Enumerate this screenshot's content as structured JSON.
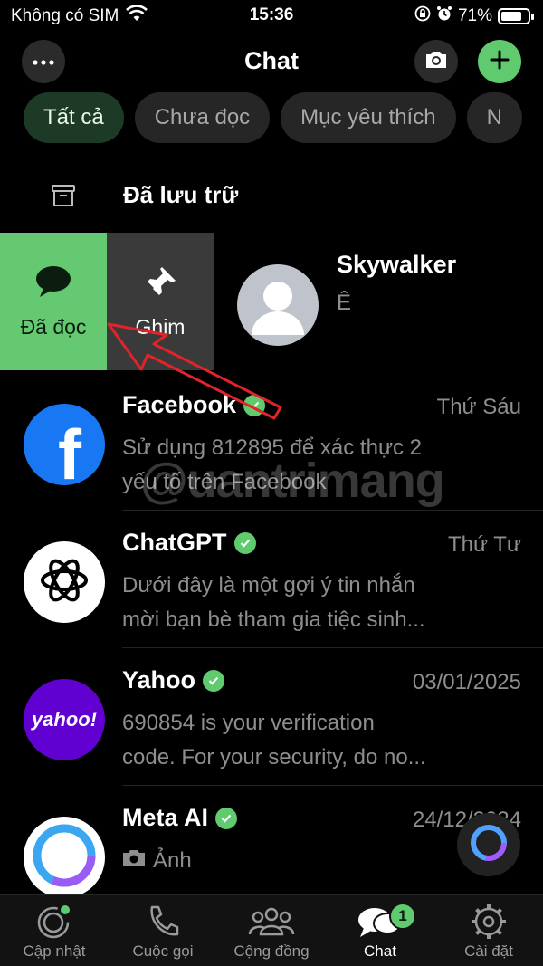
{
  "status_bar": {
    "carrier": "Không có SIM",
    "time": "15:36",
    "battery": "71%"
  },
  "header": {
    "title": "Chat"
  },
  "filters": [
    "Tất cả",
    "Chưa đọc",
    "Mục yêu thích",
    "N"
  ],
  "archived": {
    "label": "Đã lưu trữ"
  },
  "swipe_actions": {
    "read_label": "Đã đọc",
    "pin_label": "Ghim"
  },
  "swiped_chat": {
    "name": "Skywalker",
    "preview": "Ê"
  },
  "chats": [
    {
      "name": "Facebook",
      "date": "Thứ Sáu",
      "preview_line1": "Sử dụng 812895 để xác thực 2",
      "preview_line2": "yếu tố trên Facebook"
    },
    {
      "name": "ChatGPT",
      "date": "Thứ Tư",
      "preview_line1": "Dưới đây là một gợi ý tin nhắn",
      "preview_line2": "mời bạn bè tham gia tiệc sinh..."
    },
    {
      "name": "Yahoo",
      "date": "03/01/2025",
      "preview_line1": "690854 is your verification",
      "preview_line2": "code. For your security, do no..."
    },
    {
      "name": "Meta AI",
      "date": "24/12/2024",
      "preview_line1": "Ảnh",
      "preview_line2": ""
    }
  ],
  "avatar_text": {
    "facebook": "f",
    "yahoo": "yahoo!"
  },
  "tabs": [
    {
      "label": "Cập nhật"
    },
    {
      "label": "Cuộc gọi"
    },
    {
      "label": "Cộng đồng"
    },
    {
      "label": "Chat",
      "badge": "1"
    },
    {
      "label": "Cài đặt"
    }
  ],
  "watermark": "@uantrimang",
  "colors": {
    "accent": "#5fcb6e",
    "read_action": "#64c970",
    "pin_action": "#3a3a3a",
    "facebook": "#1877f2",
    "yahoo": "#6001d2"
  },
  "icons": [
    "wifi-icon",
    "lock-rotation-icon",
    "alarm-icon",
    "more-icon",
    "camera-icon",
    "plus-icon",
    "archive-icon",
    "chat-bubble-icon",
    "pin-icon",
    "verified-icon",
    "updates-icon",
    "phone-icon",
    "communities-icon",
    "chats-icon",
    "settings-icon"
  ]
}
